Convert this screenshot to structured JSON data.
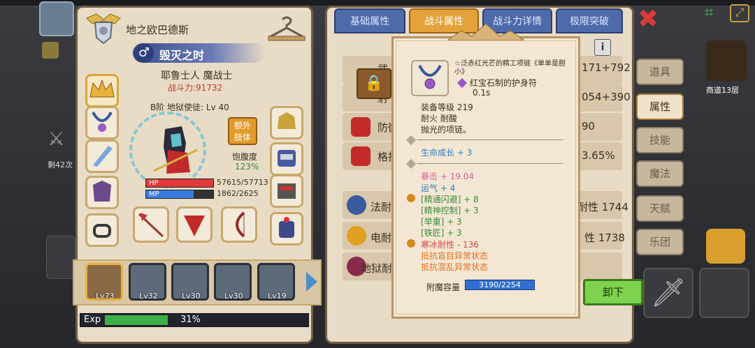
{
  "character": {
    "name": "地之欧巴德斯",
    "title": "毁灭之时",
    "gender_symbol": "♂",
    "class": "耶鲁士人 魔战士",
    "power": "战斗力:91732",
    "rank": "B阶 地狱使徒: Lv 40",
    "extra_button": "额外\n肢体",
    "satiety_label": "饱腹度",
    "satiety_value": "123%",
    "hp_label": "HP",
    "hp_value": "57615/57713",
    "hp_ratio": 0.998,
    "mp_label": "MP",
    "mp_value": "1862/2625",
    "mp_ratio": 0.709,
    "exp_label": "Exp",
    "exp_percent": "31%",
    "exp_ratio": 0.31
  },
  "party": [
    {
      "level": "Lv73",
      "selected": true
    },
    {
      "level": "Lv32",
      "selected": false
    },
    {
      "level": "Lv30",
      "selected": false
    },
    {
      "level": "Lv30",
      "selected": false
    },
    {
      "level": "Lv19",
      "selected": false
    }
  ],
  "tabs": [
    {
      "label": "基础属性",
      "active": false
    },
    {
      "label": "战斗属性",
      "active": true
    },
    {
      "label": "战斗力详情",
      "active": false
    },
    {
      "label": "极限突破",
      "active": false
    }
  ],
  "stats": [
    {
      "name": "武",
      "value": "171+792"
    },
    {
      "name": "射",
      "value": "054+390"
    },
    {
      "name": "防御",
      "value": "90"
    },
    {
      "name": "格挡",
      "value": "3.65%"
    },
    {
      "name": "法耐性",
      "value": "耐性 1744"
    },
    {
      "name": "电耐性",
      "value": "性 1738"
    },
    {
      "name": "地狱耐",
      "value": ""
    }
  ],
  "side_menu": [
    {
      "label": "道具",
      "active": false
    },
    {
      "label": "属性",
      "active": true
    },
    {
      "label": "技能",
      "active": false
    },
    {
      "label": "魔法",
      "active": false
    },
    {
      "label": "天赋",
      "active": false
    },
    {
      "label": "乐团",
      "active": false
    }
  ],
  "floor_label": "商道13层",
  "side_count": "剩42次",
  "tooltip": {
    "title": "☆泛赤红光芒的精工项链《单单是胆小》",
    "name": "红宝石制的护身符",
    "time": "0.1s",
    "equip_level": "装备等级 219",
    "props": "耐火  耐酸",
    "desc": "抛光的项链。",
    "growth": "生命成长 + 3",
    "crit": "暴击 + 19.04",
    "luck": "运气 + 4",
    "bonus": [
      "[精通闪避] + 8",
      "[精神控制] + 3",
      "[举重] + 3",
      "[铁匠] + 3"
    ],
    "ice_res": "寒冰耐性 - 136",
    "resist1": "抵抗盲目异常状态",
    "resist2": "抵抗混乱异常状态",
    "enchant_label": "附魔容量",
    "enchant_value": "3190/2254",
    "unequip": "卸下",
    "info": "i"
  },
  "colors": {
    "hp": "#e03a3a",
    "mp": "#3a7be0",
    "exp": "#3fae49",
    "tab_active": "#e3a23a",
    "tab_inactive": "#4f6aa8",
    "power_red": "#c0392b",
    "unequip_green": "#7ed24e"
  }
}
